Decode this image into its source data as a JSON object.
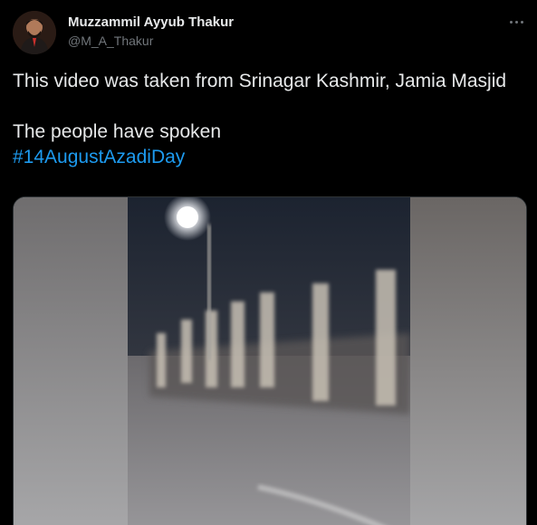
{
  "tweet": {
    "author": {
      "display_name": "Muzzammil Ayyub Thakur",
      "handle": "@M_A_Thakur",
      "avatar_icon": "profile-photo"
    },
    "more_icon": "more-options-icon",
    "text_lines": [
      "This video was taken from Srinagar Kashmir, Jamia Masjid",
      "The people have spoken"
    ],
    "hashtag": "#14AugustAzadiDay",
    "media": {
      "type": "video",
      "description_icon": "video-thumbnail"
    }
  },
  "colors": {
    "background": "#000000",
    "text": "#e7e9ea",
    "secondary": "#71767b",
    "link": "#1d9bf0"
  }
}
